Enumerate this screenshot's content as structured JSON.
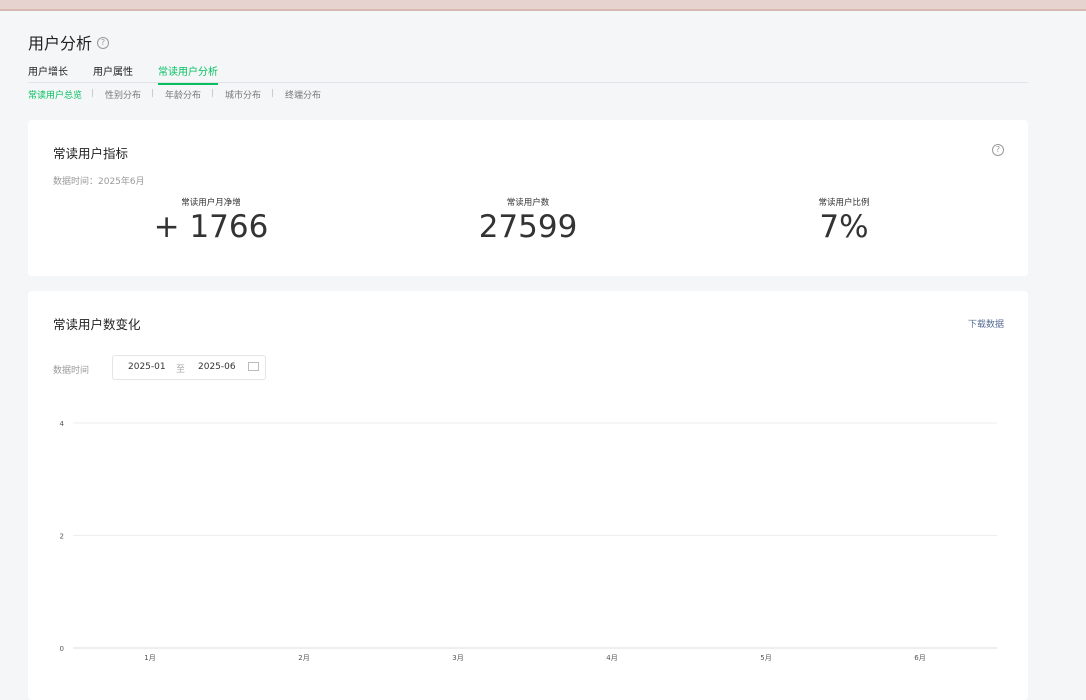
{
  "page": {
    "title": "用户分析",
    "help_icon": "question-icon"
  },
  "tabs": [
    "用户增长",
    "用户属性",
    "常读用户分析"
  ],
  "active_tab": 2,
  "subtabs": [
    "常读用户总览",
    "性别分布",
    "年龄分布",
    "城市分布",
    "终端分布"
  ],
  "active_subtab": 0,
  "indicator_card": {
    "title": "常读用户指标",
    "meta": "数据时间：2025年6月",
    "metrics": [
      {
        "label": "常读用户月净增",
        "value": "+ 1766"
      },
      {
        "label": "常读用户数",
        "value": "27599"
      },
      {
        "label": "常读用户比例",
        "value": "7%"
      }
    ]
  },
  "trend_card": {
    "title": "常读用户数变化",
    "download_label": "下载数据",
    "range_label": "数据时间",
    "range_start": "2025-01",
    "range_sep": "至",
    "range_end": "2025-06"
  },
  "chart_data": {
    "type": "line",
    "categories": [
      "1月",
      "2月",
      "3月",
      "4月",
      "5月",
      "6月"
    ],
    "y_ticks": [
      0,
      2,
      4
    ],
    "ylim": [
      0,
      4
    ],
    "grid": true,
    "series": [],
    "colors": {
      "grid": "#eeeeee",
      "axis": "#dddddd",
      "tick_text": "#555555"
    }
  }
}
